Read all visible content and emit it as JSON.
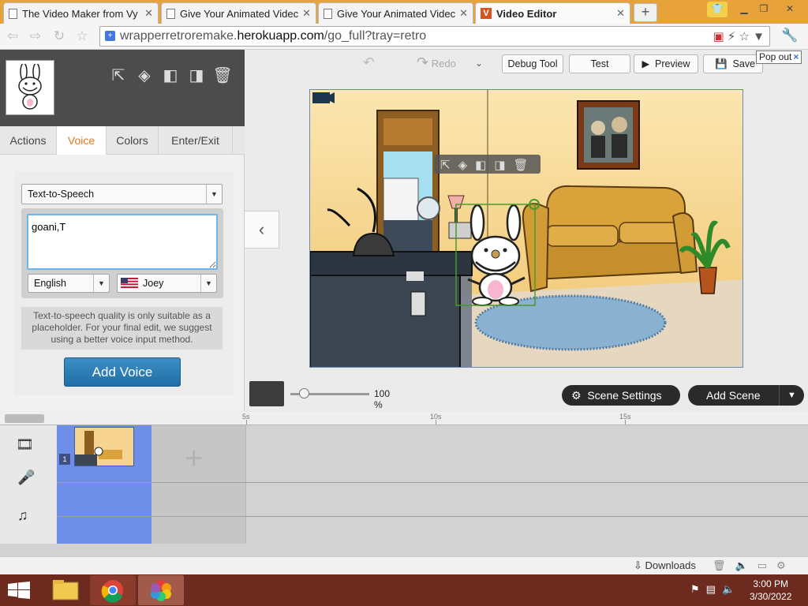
{
  "browser": {
    "tabs": [
      {
        "title": "The Video Maker from Vy"
      },
      {
        "title": "Give Your Animated Videc"
      },
      {
        "title": "Give Your Animated Videc"
      },
      {
        "title": "Video Editor"
      }
    ],
    "url_prefix": "wrapperretroremake.",
    "url_host": "herokuapp.com",
    "url_path": "/go_full?tray=retro",
    "popout_label": "Pop out",
    "popout_close": "×",
    "downloads_label": "Downloads"
  },
  "toolbar": {
    "redo_label": "Redo",
    "debug_label": "Debug Tool",
    "test_label": "Test",
    "preview_label": "Preview",
    "save_label": "Save"
  },
  "panel": {
    "tabs": [
      "Actions",
      "Voice",
      "Colors",
      "Enter/Exit"
    ],
    "active_tab": "Voice",
    "voice_method": "Text-to-Speech",
    "tts_text": "goani,T",
    "language": "English",
    "voice": "Joey",
    "note": "Text-to-speech quality is only suitable as a placeholder. For your final edit, we suggest using a better voice input method.",
    "add_voice_label": "Add Voice"
  },
  "stage": {
    "zoom_label": "100 %",
    "scene_settings_label": "Scene Settings",
    "add_scene_label": "Add Scene"
  },
  "timeline": {
    "ruler_labels": [
      "5s",
      "10s",
      "15s"
    ],
    "scene_number": "1"
  },
  "taskbar": {
    "time": "3:00 PM",
    "date": "3/30/2022"
  },
  "colors": {
    "tab_bar": "#e8a23a",
    "accent_orange": "#e07a1f",
    "add_voice_blue": "#2a7cb8",
    "timeline_scene": "#6e8ee8",
    "taskbar": "#6d2a1e"
  }
}
